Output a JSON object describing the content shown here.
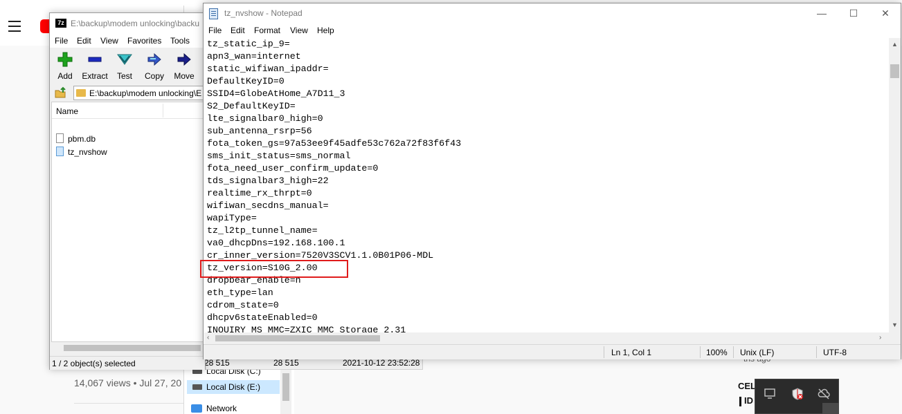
{
  "background_page": {
    "views_date": "14,067 views • Jul 27, 20",
    "time_ago": "ths ago",
    "side_text_1": "CEL",
    "side_text_2": "ID L"
  },
  "explorer": {
    "items": [
      {
        "label": "Local Disk (C:)"
      },
      {
        "label": "Local Disk (E:)"
      },
      {
        "label": "Network"
      }
    ]
  },
  "sevenzip": {
    "title": "E:\\backup\\modem unlocking\\backu",
    "menu": [
      "File",
      "Edit",
      "View",
      "Favorites",
      "Tools"
    ],
    "toolbar": [
      {
        "label": "Add",
        "icon": "add-icon"
      },
      {
        "label": "Extract",
        "icon": "extract-icon"
      },
      {
        "label": "Test",
        "icon": "test-icon"
      },
      {
        "label": "Copy",
        "icon": "copy-icon"
      },
      {
        "label": "Move",
        "icon": "move-icon"
      }
    ],
    "address": "E:\\backup\\modem unlocking\\E",
    "column_name": "Name",
    "files": [
      {
        "name": "pbm.db"
      },
      {
        "name": "tz_nvshow"
      }
    ],
    "status": "1 / 2 object(s) selected",
    "status_ext": {
      "size1": "28 515",
      "size2": "28 515",
      "modified": "2021-10-12 23:52:28"
    }
  },
  "notepad": {
    "title": "tz_nvshow - Notepad",
    "controls": {
      "minimize": "—",
      "maximize": "☐",
      "close": "✕"
    },
    "menu": [
      "File",
      "Edit",
      "Format",
      "View",
      "Help"
    ],
    "lines": [
      "tz_static_ip_9=",
      "apn3_wan=internet",
      "static_wifiwan_ipaddr=",
      "DefaultKeyID=0",
      "SSID4=GlobeAtHome_A7D11_3",
      "S2_DefaultKeyID=",
      "lte_signalbar0_high=0",
      "sub_antenna_rsrp=56",
      "fota_token_gs=97a53ee9f45adfe53c762a72f83f6f43",
      "sms_init_status=sms_normal",
      "fota_need_user_confirm_update=0",
      "tds_signalbar3_high=22",
      "realtime_rx_thrpt=0",
      "wifiwan_secdns_manual=",
      "wapiType=",
      "tz_l2tp_tunnel_name=",
      "va0_dhcpDns=192.168.100.1",
      "cr_inner_version=7520V3SCV1.1.0B01P06-MDL",
      "tz_version=S10G_2.00",
      "dropbear_enable=n",
      "eth_type=lan",
      "cdrom_state=0",
      "dhcpv6stateEnabled=0",
      "INQUIRY_MS_MMC=ZXIC MMC Storage 2.31"
    ],
    "status": {
      "position": "Ln 1, Col 1",
      "zoom": "100%",
      "line_ending": "Unix (LF)",
      "encoding": "UTF-8"
    }
  },
  "colors": {
    "highlight": "#e01b1b",
    "youtube_red": "#ff0000"
  }
}
